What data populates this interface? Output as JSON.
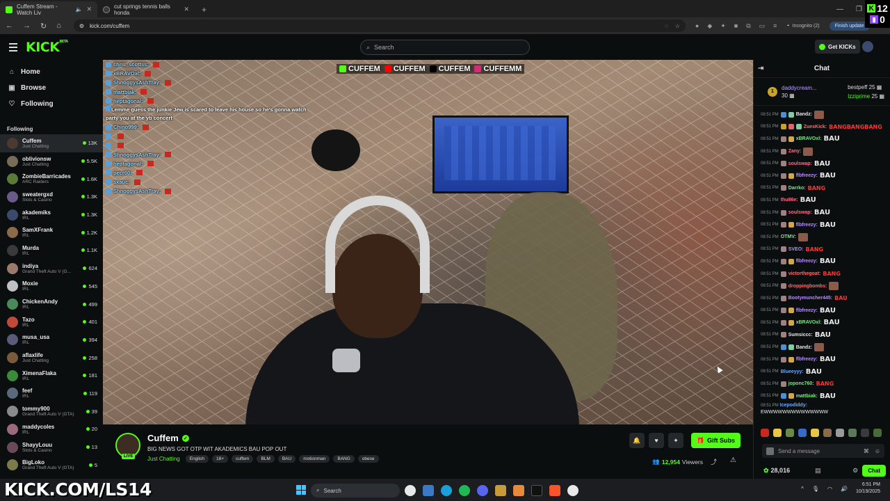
{
  "browser": {
    "tabs": [
      {
        "title": "Cuffem Stream - Watch Liv",
        "active": true
      },
      {
        "title": "cut springs tennis balls honda",
        "active": false
      }
    ],
    "url": "kick.com/cuffem",
    "incognito_label": "Incognito (2)",
    "finish_update_label": "Finish update"
  },
  "overlay_counter": {
    "kick_count": "12",
    "twitch_count": "0"
  },
  "header": {
    "logo": "KICK",
    "logo_sup": "BETA",
    "search_placeholder": "Search",
    "get_kicks_label": "Get KICKs"
  },
  "sidebar": {
    "nav": [
      {
        "label": "Home",
        "icon": "home-icon"
      },
      {
        "label": "Browse",
        "icon": "browse-icon"
      },
      {
        "label": "Following",
        "icon": "heart-icon"
      }
    ],
    "following_title": "Following",
    "channels": [
      {
        "name": "Cuffem",
        "category": "Just Chatting",
        "viewers": "13K",
        "active": true,
        "color": "#4a3a30"
      },
      {
        "name": "oblivionsw",
        "category": "Just Chatting",
        "viewers": "5.5K",
        "color": "#7a6a5a"
      },
      {
        "name": "ZombieBarricades",
        "category": "ARC Raiders",
        "viewers": "1.6K",
        "color": "#5a7a3a"
      },
      {
        "name": "sweatergxd",
        "category": "Slots & Casino",
        "viewers": "1.3K",
        "color": "#6a5a8a"
      },
      {
        "name": "akademiks",
        "category": "IRL",
        "viewers": "1.3K",
        "color": "#3a4a6a"
      },
      {
        "name": "SamXFrank",
        "category": "IRL",
        "viewers": "1.2K",
        "color": "#8a6a4a"
      },
      {
        "name": "Murda",
        "category": "IRL",
        "viewers": "1.1K",
        "color": "#3a3a3a"
      },
      {
        "name": "indiya",
        "category": "Grand Theft Auto V (G...",
        "viewers": "624",
        "color": "#9a7a6a"
      },
      {
        "name": "Moxie",
        "category": "IRL",
        "viewers": "545",
        "color": "#c0c0c0"
      },
      {
        "name": "ChickenAndy",
        "category": "IRL",
        "viewers": "499",
        "color": "#4a8a5a"
      },
      {
        "name": "Tazo",
        "category": "IRL",
        "viewers": "401",
        "color": "#c04a3a"
      },
      {
        "name": "musa_usa",
        "category": "IRL",
        "viewers": "394",
        "color": "#5a5a7a"
      },
      {
        "name": "aflaxlife",
        "category": "Just Chatting",
        "viewers": "258",
        "color": "#7a5a3a"
      },
      {
        "name": "XimenaFlaka",
        "category": "IRL",
        "viewers": "181",
        "color": "#3a8a3a"
      },
      {
        "name": "feef",
        "category": "IRL",
        "viewers": "119",
        "color": "#5a6a7a"
      },
      {
        "name": "tommy900",
        "category": "Grand Theft Auto V (GTA)",
        "viewers": "39",
        "color": "#8a8a8a"
      },
      {
        "name": "maddycoles",
        "category": "IRL",
        "viewers": "20",
        "color": "#9a6a7a"
      },
      {
        "name": "ShayyLouu",
        "category": "Slots & Casino",
        "viewers": "13",
        "color": "#6a4a5a"
      },
      {
        "name": "BigLoko",
        "category": "Grand Theft Auto V (GTA)",
        "viewers": "5",
        "color": "#7a7a4a"
      }
    ]
  },
  "video": {
    "banner": [
      "CUFFEM",
      "CUFFEM",
      "CUFFEM",
      "CUFFEMM"
    ],
    "banner_colors": [
      "#53fc18",
      "#ff0000",
      "#000000",
      "#d62976"
    ],
    "overlay_chat": [
      {
        "user": "chris_scottss:",
        "text": ""
      },
      {
        "user": "xBRAVOxl:",
        "text": ""
      },
      {
        "user": "ShnoggysAshTray:",
        "text": ""
      },
      {
        "user": "mattbiak:",
        "text": ""
      },
      {
        "user": "heptagonal:",
        "text": ""
      },
      {
        "user": "",
        "text": "Lemme guess the junkie Jew is scared to leave his house so he's gonna watch party you at the yb concert",
        "long": true
      },
      {
        "user": "Chino999:",
        "text": ""
      },
      {
        "user": "",
        "text": ""
      },
      {
        "user": "",
        "text": ""
      },
      {
        "user": "ShnoggysAshTray:",
        "text": ""
      },
      {
        "user": "heptagonal:",
        "text": ""
      },
      {
        "user": "pecr00:",
        "text": ""
      },
      {
        "user": "sxauc:",
        "text": ""
      },
      {
        "user": "ShnoggysAshTray:",
        "text": ""
      }
    ]
  },
  "stream": {
    "name": "Cuffem",
    "live_label": "LIVE",
    "title": "BIG NEWS GOT OTP WIT AKADEMICS BAU POP OUT",
    "category": "Just Chatting",
    "tags": [
      "English",
      "18+",
      "cuffem",
      "BLM",
      "BAU",
      "motionman",
      "BANG",
      "obese"
    ],
    "gift_subs_label": "Gift Subs",
    "viewers_count": "12,954",
    "viewers_label": "Viewers"
  },
  "chat": {
    "title": "Chat",
    "top_gifter": {
      "rank": "1",
      "name": "daddycream...",
      "count": "30"
    },
    "gifters": [
      {
        "name": "bestpeff",
        "count": "25"
      },
      {
        "name": "Izziprime",
        "count": "25"
      }
    ],
    "messages": [
      {
        "time": "08:51 PM",
        "user": "Bandz:",
        "color": "#e6e6e6",
        "emote": "img",
        "badges": [
          "#4a90d9",
          "#7ad0a0"
        ]
      },
      {
        "time": "08:51 PM",
        "user": "ZuesKick:",
        "color": "#ff6b6b",
        "emote": "BANGBANGBANG",
        "emote_red": true,
        "badges": [
          "#c9a227",
          "#e06666",
          "#7ad0a0"
        ]
      },
      {
        "time": "08:51 PM",
        "user": "xBRAVOxl:",
        "color": "#7ee787",
        "emote": "BAU",
        "badges": [
          "#a08080",
          "#d4a64a"
        ]
      },
      {
        "time": "08:51 PM",
        "user": "Zany:",
        "color": "#ff6b8a",
        "emote": "img",
        "badges": [
          "#a08080"
        ]
      },
      {
        "time": "08:51 PM",
        "user": "soulswap:",
        "color": "#ff6b8a",
        "emote": "BAU",
        "badges": [
          "#a08080"
        ]
      },
      {
        "time": "08:51 PM",
        "user": "flbfreezy:",
        "color": "#b98cff",
        "emote": "BAU",
        "badges": [
          "#a08080",
          "#d4a64a"
        ]
      },
      {
        "time": "08:51 PM",
        "user": "Darrko:",
        "color": "#7ee787",
        "emote": "BANG",
        "emote_red": true,
        "badges": [
          "#a08080"
        ]
      },
      {
        "time": "08:51 PM",
        "user": "thu86e:",
        "color": "#ff6b8a",
        "emote": "BAU",
        "badges": []
      },
      {
        "time": "08:51 PM",
        "user": "soulswap:",
        "color": "#ff6b8a",
        "emote": "BAU",
        "badges": [
          "#a08080"
        ]
      },
      {
        "time": "08:51 PM",
        "user": "flbfreezy:",
        "color": "#b98cff",
        "emote": "BAU",
        "badges": [
          "#a08080",
          "#d4a64a"
        ]
      },
      {
        "time": "08:51 PM",
        "user": "OTMV:",
        "color": "#7ee787",
        "emote": "img",
        "badges": []
      },
      {
        "time": "08:51 PM",
        "user": "SVEO:",
        "color": "#b98cff",
        "emote": "BANG",
        "emote_red": true,
        "badges": [
          "#a08080"
        ]
      },
      {
        "time": "08:51 PM",
        "user": "flbfreezy:",
        "color": "#b98cff",
        "emote": "BAU",
        "badges": [
          "#a08080",
          "#d4a64a"
        ]
      },
      {
        "time": "08:51 PM",
        "user": "victorthegoat:",
        "color": "#ff6b6b",
        "emote": "BANG",
        "emote_red": true,
        "badges": [
          "#a08080"
        ]
      },
      {
        "time": "08:51 PM",
        "user": "droppingbombs:",
        "color": "#ff6b6b",
        "emote": "img",
        "badges": [
          "#a08080"
        ]
      },
      {
        "time": "08:51 PM",
        "user": "Bootymuncher445:",
        "color": "#b98cff",
        "emote": "BAU",
        "emote_red": true,
        "badges": [
          "#a08080"
        ]
      },
      {
        "time": "08:51 PM",
        "user": "flbfreezy:",
        "color": "#b98cff",
        "emote": "BAU",
        "badges": [
          "#a08080",
          "#d4a64a"
        ]
      },
      {
        "time": "08:51 PM",
        "user": "xBRAVOxl:",
        "color": "#7ee787",
        "emote": "BAU",
        "badges": [
          "#a08080",
          "#d4a64a"
        ]
      },
      {
        "time": "08:51 PM",
        "user": "Sumsiccc:",
        "color": "#e6e6e6",
        "emote": "BAU",
        "badges": [
          "#a08080"
        ]
      },
      {
        "time": "08:51 PM",
        "user": "Bandz:",
        "color": "#e6e6e6",
        "emote": "img",
        "badges": [
          "#4a90d9",
          "#7ad0a0"
        ]
      },
      {
        "time": "08:51 PM",
        "user": "flbfreezy:",
        "color": "#b98cff",
        "emote": "BAU",
        "badges": [
          "#a08080",
          "#d4a64a"
        ]
      },
      {
        "time": "08:51 PM",
        "user": "Blueeyyy:",
        "color": "#6aa8ff",
        "emote": "BAU",
        "badges": []
      },
      {
        "time": "08:51 PM",
        "user": "joponc760:",
        "color": "#7ee787",
        "emote": "BANG",
        "emote_red": true,
        "badges": [
          "#a08080"
        ]
      },
      {
        "time": "08:51 PM",
        "user": "mattbiak:",
        "color": "#7ee787",
        "emote": "BAU",
        "badges": [
          "#4a90d9",
          "#d4a64a"
        ]
      }
    ],
    "last_message": {
      "time": "08:51 PM",
      "user": "Icepodiddy:",
      "text": "EWWWWWWWWWWWWWW"
    },
    "input_placeholder": "Send a message",
    "points": "28,016",
    "chat_button_label": "Chat"
  },
  "taskbar": {
    "brand_overlay": "KICK.COM/LS14",
    "search_label": "Search",
    "time": "6:51 PM",
    "date": "10/19/2025"
  }
}
